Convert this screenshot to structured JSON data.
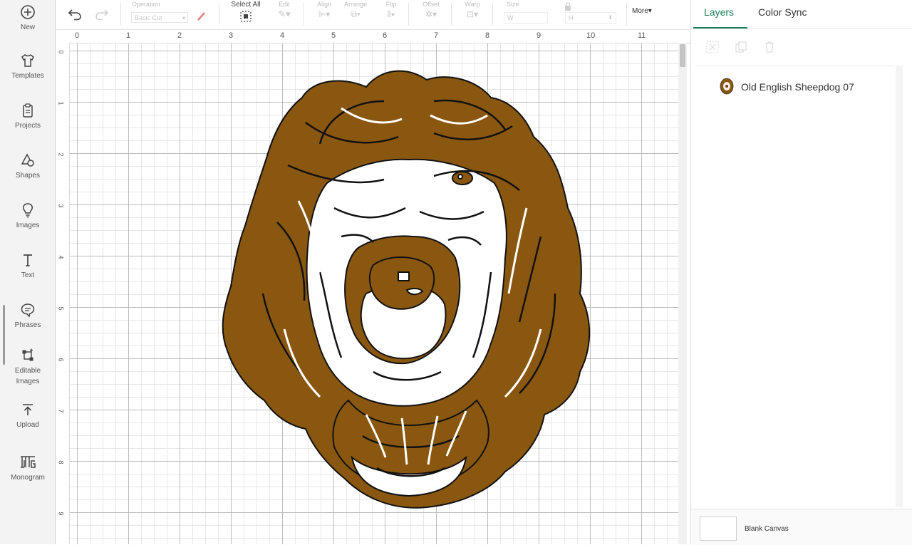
{
  "sidebar": {
    "items": [
      {
        "label": "New",
        "icon": "plus-circle-icon"
      },
      {
        "label": "Templates",
        "icon": "shirt-icon"
      },
      {
        "label": "Projects",
        "icon": "clipboard-icon"
      },
      {
        "label": "Shapes",
        "icon": "shapes-icon"
      },
      {
        "label": "Images",
        "icon": "lightbulb-icon"
      },
      {
        "label": "Text",
        "icon": "text-icon"
      },
      {
        "label": "Phrases",
        "icon": "speech-bubble-icon"
      },
      {
        "label": "Editable Images",
        "icon": "editable-image-icon"
      },
      {
        "label": "Upload",
        "icon": "upload-icon"
      },
      {
        "label": "Monogram",
        "icon": "monogram-icon"
      }
    ]
  },
  "toolbar": {
    "operation_label": "Operation",
    "operation_value": "Basic Cut",
    "select_all_label": "Select All",
    "edit_label": "Edit",
    "align_label": "Align",
    "arrange_label": "Arrange",
    "flip_label": "Flip",
    "offset_label": "Offset",
    "warp_label": "Warp",
    "size_label": "Size",
    "width_prefix": "W",
    "height_prefix": "H",
    "more_label": "More"
  },
  "ruler": {
    "top": [
      "0",
      "1",
      "2",
      "3",
      "4",
      "5",
      "6",
      "7",
      "8",
      "9",
      "10",
      "11"
    ],
    "left": [
      "0",
      "1",
      "2",
      "3",
      "4",
      "5",
      "6",
      "7",
      "8",
      "9"
    ]
  },
  "canvas": {
    "fill_color": "#8a5710",
    "outline_color": "#111111"
  },
  "panel": {
    "tabs": [
      "Layers",
      "Color Sync"
    ],
    "active_tab": "Layers",
    "accent_color": "#1b7e5a",
    "layers": [
      {
        "name": "Old English Sheepdog 07"
      }
    ],
    "footer_label": "Blank Canvas"
  }
}
